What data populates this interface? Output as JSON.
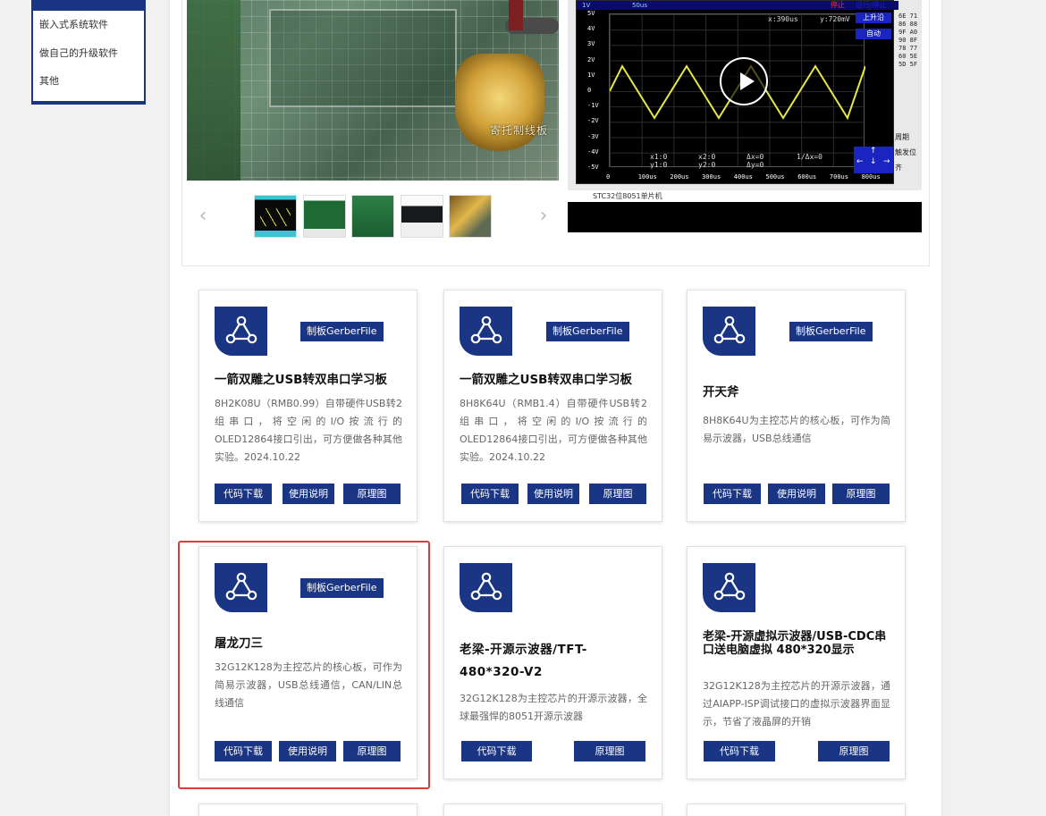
{
  "side_menu": {
    "items": [
      {
        "label": "嵌入式系统软件"
      },
      {
        "label": "做自己的升级软件"
      },
      {
        "label": "其他"
      }
    ]
  },
  "gallery": {
    "main_image_caption": "寄托制线板",
    "thumbnails": [
      "oscilloscope-thumb",
      "pcb-thumb-1",
      "pcb-thumb-2",
      "pcb-thumb-3",
      "dragon-thumb"
    ]
  },
  "video": {
    "toolbar": {
      "left": "1V",
      "right": "50us"
    },
    "stop_label": "停止",
    "run_stop_label": "运行/停止",
    "rising_edge_label": "上升沿",
    "auto_label": "自动",
    "cursor_x": "x:390us",
    "cursor_y": "y:720mV",
    "y_ticks": [
      "5V",
      "4V",
      "3V",
      "2V",
      "1V",
      "0",
      "-1V",
      "-2V",
      "-3V",
      "-4V",
      "-5V"
    ],
    "x_ticks": [
      "0",
      "100us",
      "200us",
      "300us",
      "400us",
      "500us",
      "600us",
      "700us",
      "800us"
    ],
    "readouts": {
      "x1": "x1:0",
      "y1": "y1:0",
      "x2": "x2:0",
      "y2": "y2:0",
      "dx": "Δx=0",
      "dy": "Δy=0",
      "inv_dx": "1/Δx=0"
    },
    "hex_values": [
      "6E 71",
      "86 88",
      "9F A0",
      "90 8F",
      "78 77",
      "60 5E",
      "5D 5F"
    ],
    "side_labels": [
      "周期",
      "触发位",
      "齐"
    ],
    "footer": "STC32位8051单片机"
  },
  "cards": [
    {
      "gerber_label": "制板GerberFile",
      "title": "一箭双雕之USB转双串口学习板",
      "desc": "8H2K08U（RMB0.99）自带硬件USB转2组串口，将空闲的I/O按流行的OLED12864接口引出，可方便做各种其他实验。2024.10.22",
      "buttons": [
        "代码下载",
        "使用说明",
        "原理图"
      ]
    },
    {
      "gerber_label": "制板GerberFile",
      "title": "一箭双雕之USB转双串口学习板",
      "desc": "8H8K64U（RMB1.4）自带硬件USB转2组串口，将空闲的I/O按流行的OLED12864接口引出，可方便做各种其他实验。2024.10.22",
      "buttons": [
        "代码下载",
        "使用说明",
        "原理图"
      ]
    },
    {
      "gerber_label": "制板GerberFile",
      "title": "开天斧",
      "desc": "8H8K64U为主控芯片的核心板，可作为简易示波器，USB总线通信",
      "buttons": [
        "代码下载",
        "使用说明",
        "原理图"
      ]
    },
    {
      "gerber_label": "制板GerberFile",
      "title": "屠龙刀三",
      "desc": "32G12K128为主控芯片的核心板，可作为简易示波器，USB总线通信，CAN/LIN总线通信",
      "buttons": [
        "代码下载",
        "使用说明",
        "原理图"
      ]
    },
    {
      "title": "老梁-开源示波器/TFT-480*320-V2",
      "desc": "32G12K128为主控芯片的开源示波器，全球最强悍的8051开源示波器",
      "buttons": [
        "代码下载",
        "原理图"
      ]
    },
    {
      "title": "老梁-开源虚拟示波器/USB-CDC串口送电脑虚拟 480*320显示",
      "desc": "32G12K128为主控芯片的开源示波器，通过AIAPP-ISP调试接口的虚拟示波器界面显示，节省了液晶屏的开销",
      "buttons": [
        "代码下载",
        "原理图"
      ]
    }
  ],
  "colors": {
    "accent": "#1b3585",
    "highlight": "#e03b3b"
  }
}
